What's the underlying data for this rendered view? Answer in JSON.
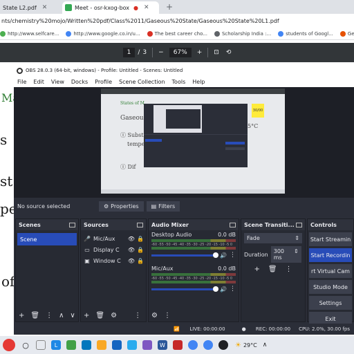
{
  "browser": {
    "tabs": [
      {
        "label": "State L2.pdf",
        "active": false
      },
      {
        "label": "Meet - osr-kxog-box",
        "active": true
      }
    ],
    "address": "nts/chemistry%20mojo/Written%20pdf/Class%2011/Gaseous%20State/Gaseous%20State%20L1.pdf",
    "bookmarks": [
      {
        "label": "http://www.selfcare...",
        "color": "#4caf50"
      },
      {
        "label": "http://www.google.co.in/u...",
        "color": "#4285f4"
      },
      {
        "label": "The best career cho...",
        "color": "#d93025"
      },
      {
        "label": "Scholarship India :...",
        "color": "#5f6368"
      },
      {
        "label": "students of  Googl...",
        "color": "#4285f4"
      },
      {
        "label": "Get latest Quick He...",
        "color": "#e65100"
      }
    ]
  },
  "pdf": {
    "page_current": "1",
    "page_total": "3",
    "zoom": "67%",
    "minus": "−",
    "plus": "+"
  },
  "obs": {
    "title": "OBS 28.0.3 (64-bit, windows) - Profile: Untitled - Scenes: Untitled",
    "menu": [
      "File",
      "Edit",
      "View",
      "Docks",
      "Profile",
      "Scene Collection",
      "Tools",
      "Help"
    ],
    "no_source": "No source selected",
    "properties_label": "Properties",
    "filters_label": "Filters",
    "docks": {
      "scenes": {
        "title": "Scenes",
        "items": [
          "Scene"
        ]
      },
      "sources": {
        "title": "Sources",
        "items": [
          {
            "label": "Mic/Aux",
            "icon": "mic-icon"
          },
          {
            "label": "Display C",
            "icon": "monitor-icon"
          },
          {
            "label": "Window C",
            "icon": "window-icon"
          }
        ]
      },
      "mixer": {
        "title": "Audio Mixer",
        "channels": [
          {
            "name": "Desktop Audio",
            "level": "0.0 dB",
            "volume": 0.78
          },
          {
            "name": "Mic/Aux",
            "level": "0.0 dB",
            "volume": 0.78
          }
        ],
        "ticks": "-60 -55 -50 -45 -40 -35 -30 -25 -20 -15 -10 -5 0"
      },
      "transitions": {
        "title": "Scene Transiti...",
        "type": "Fade",
        "duration_label": "Duration",
        "duration": "300 ms"
      },
      "controls": {
        "title": "Controls",
        "buttons": [
          "Start Streamin",
          "Start Recordin",
          "rt Virtual Cam",
          "Studio Mode",
          "Settings",
          "Exit"
        ]
      }
    },
    "status": {
      "live": "LIVE: 00:00:00",
      "rec": "REC: 00:00:00",
      "cpu": "CPU: 2.0%, 30.00 fps"
    }
  },
  "taskbar": {
    "temperature": "29°C"
  },
  "colors": {
    "obs_bg": "#2b2e38",
    "obs_accent": "#284cb8",
    "pdf_toolbar": "#323639"
  }
}
